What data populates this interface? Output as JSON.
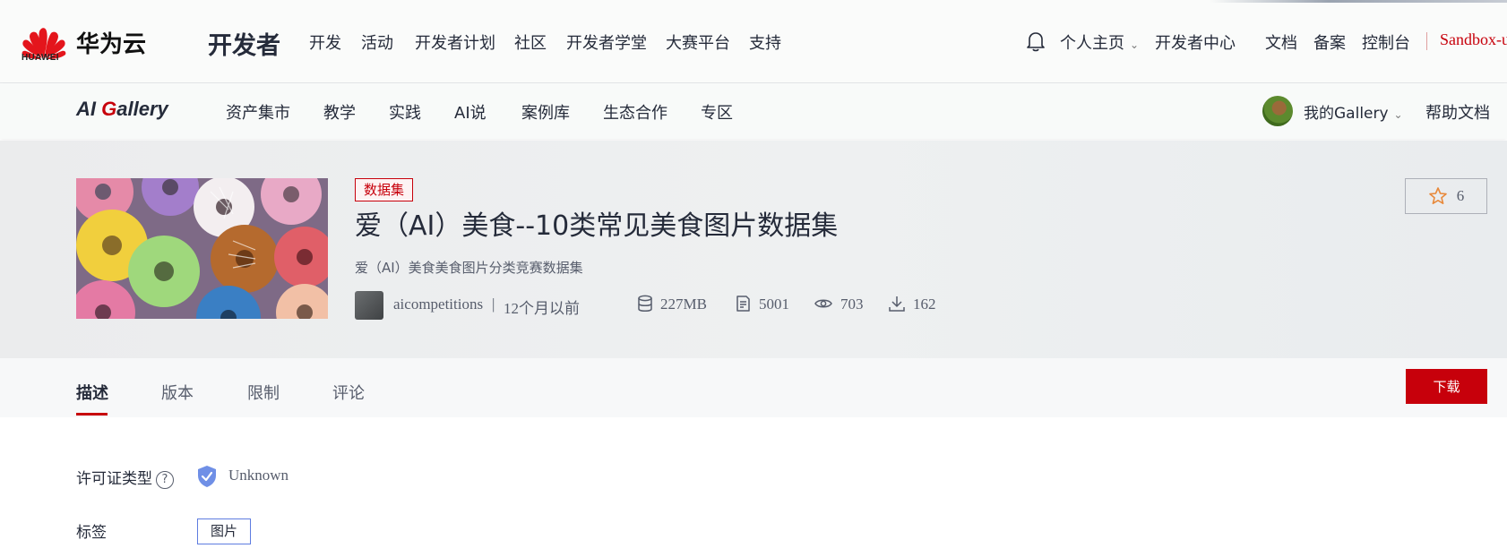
{
  "topbar": {
    "logo_word": "HUAWEI",
    "brand": "华为云",
    "section": "开发者",
    "nav": [
      "开发",
      "活动",
      "开发者计划",
      "社区",
      "开发者学堂",
      "大赛平台",
      "支持"
    ],
    "personal": "个人主页",
    "dev_center": "开发者中心",
    "right_links": [
      "文档",
      "备案",
      "控制台"
    ],
    "user": "Sandbox-u"
  },
  "subnav": {
    "title_prefix": "AI ",
    "title_g": "G",
    "title_suffix": "allery",
    "items": [
      "资产集市",
      "教学",
      "实践",
      "AI说",
      "案例库",
      "生态合作",
      "专区"
    ],
    "my_gallery": "我的Gallery",
    "help_docs": "帮助文档"
  },
  "asset": {
    "type_tag": "数据集",
    "title": "爱（AI）美食--10类常见美食图片数据集",
    "subtitle": "爱（AI）美食美食图片分类竞赛数据集",
    "author": "aicompetitions",
    "separator": "|",
    "time": "12个月以前",
    "size": "227MB",
    "files": "5001",
    "views": "703",
    "downloads": "162",
    "stars": "6"
  },
  "tabs": {
    "items": [
      "描述",
      "版本",
      "限制",
      "评论"
    ],
    "active": "描述",
    "download_label": "下载"
  },
  "details": {
    "license_label": "许可证类型",
    "license_help": "?",
    "license_value": "Unknown",
    "tags_label": "标签",
    "tags": [
      "图片"
    ]
  },
  "colors": {
    "brand_red": "#c7000b",
    "text_primary": "#252b3a",
    "text_secondary": "#575d6c",
    "chip_border": "#5e7ce0"
  },
  "icons": [
    "huawei-logo",
    "bell-icon",
    "chevron-down-icon",
    "database-icon",
    "file-icon",
    "eye-icon",
    "download-icon",
    "star-icon",
    "shield-check-icon",
    "help-icon"
  ]
}
